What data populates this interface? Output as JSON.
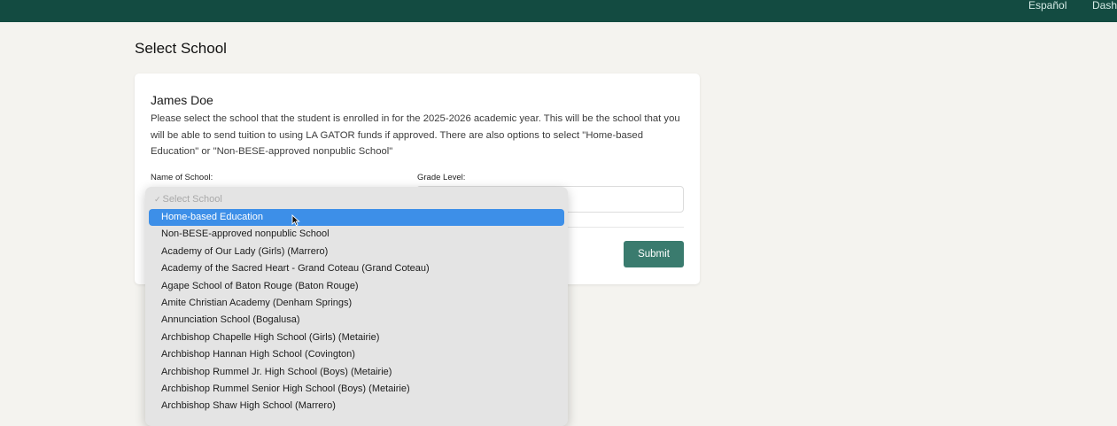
{
  "topbar": {
    "links": [
      "Español",
      "Dash"
    ]
  },
  "page": {
    "title": "Select School"
  },
  "card": {
    "student_name": "James Doe",
    "instructions": "Please select the school that the student is enrolled in for the 2025-2026 academic year. This will be the school that you will be able to send tuition to using LA GATOR funds if approved. There are also options to select \"Home-based Education\" or \"Non-BESE-approved nonpublic School\"",
    "school_label": "Name of School:",
    "grade_label": "Grade Level:",
    "grade_value": "",
    "submit_label": "Submit"
  },
  "dropdown": {
    "placeholder": "Select School",
    "selected_index": 0,
    "options": [
      "Home-based Education",
      "Non-BESE-approved nonpublic School",
      "Academy of Our Lady (Girls) (Marrero)",
      "Academy of the Sacred Heart - Grand Coteau (Grand Coteau)",
      "Agape School of Baton Rouge (Baton Rouge)",
      "Amite Christian Academy (Denham Springs)",
      "Annunciation School (Bogalusa)",
      "Archbishop Chapelle High School (Girls) (Metairie)",
      "Archbishop Hannan High School (Covington)",
      "Archbishop Rummel Jr. High School (Boys) (Metairie)",
      "Archbishop Rummel Senior High School (Boys) (Metairie)",
      "Archbishop Shaw High School (Marrero)"
    ]
  },
  "colors": {
    "topbar": "#134b41",
    "submit": "#3a7b6e",
    "highlight": "#3d8fe8",
    "background": "#f4f3ef"
  }
}
